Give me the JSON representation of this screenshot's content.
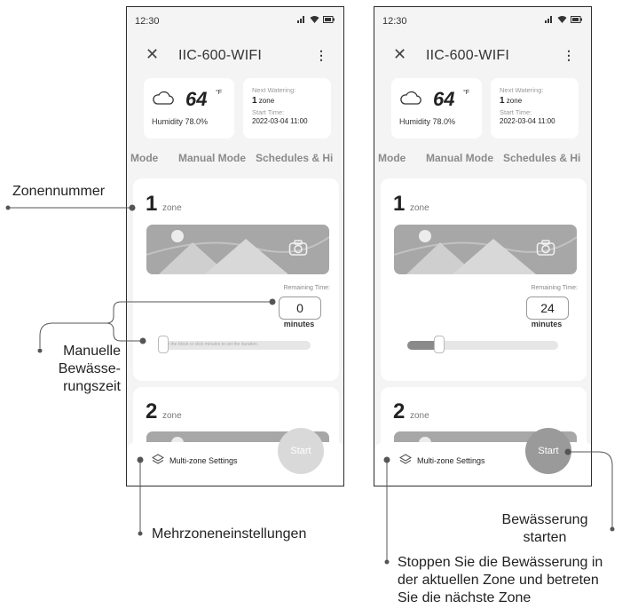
{
  "screens": [
    {
      "status": {
        "time": "12:30"
      },
      "header": {
        "title": "IIC-600-WIFI"
      },
      "weather": {
        "temp": "64",
        "unit": "°F",
        "humidity": "Humidity  78.0%"
      },
      "next_watering": {
        "label": "Next Watering:",
        "zone_num": "1",
        "zone_word": "zone",
        "start_label": "Start Time:",
        "start_time": "2022-03-04 11:00"
      },
      "tabs": [
        "Mode",
        "Manual Mode",
        "Schedules & Hi"
      ],
      "zones": [
        {
          "number": "1",
          "word": "zone"
        },
        {
          "number": "2",
          "word": "zone"
        }
      ],
      "remaining": {
        "label": "Remaining Time:",
        "value": "0",
        "unit": "minutes"
      },
      "slider": {
        "hint": "Slide the block or click minutes to set the duration.",
        "fill": 0
      },
      "multi_zone_label": "Multi-zone Settings",
      "start_label": "Start"
    },
    {
      "status": {
        "time": "12:30"
      },
      "header": {
        "title": "IIC-600-WIFI"
      },
      "weather": {
        "temp": "64",
        "unit": "°F",
        "humidity": "Humidity  78.0%"
      },
      "next_watering": {
        "label": "Next Watering:",
        "zone_num": "1",
        "zone_word": "zone",
        "start_label": "Start Time:",
        "start_time": "2022-03-04 11:00"
      },
      "tabs": [
        "Mode",
        "Manual Mode",
        "Schedules & Hi"
      ],
      "zones": [
        {
          "number": "1",
          "word": "zone"
        },
        {
          "number": "2",
          "word": "zone"
        }
      ],
      "remaining": {
        "label": "Remaining Time:",
        "value": "24",
        "unit": "minutes"
      },
      "slider": {
        "hint": "",
        "fill": 0.2
      },
      "multi_zone_label": "Multi-zone Settings",
      "start_label": "Start"
    }
  ],
  "callouts": {
    "zone_number": "Zonennummer",
    "manual_time": [
      "Manuelle",
      "Bewässe-",
      "rungszeit"
    ],
    "multi_zone": "Mehrzoneneinstellungen",
    "start_watering": [
      "Bewässerung",
      "starten"
    ],
    "stop_next": [
      "Stoppen Sie die Bewässerung in",
      "der aktuellen Zone und betreten",
      "Sie die nächste Zone"
    ]
  },
  "colors": {
    "accent_gray": "#9a9a9a",
    "card_bg": "#ffffff",
    "screen_bg": "#f4f4f4"
  }
}
